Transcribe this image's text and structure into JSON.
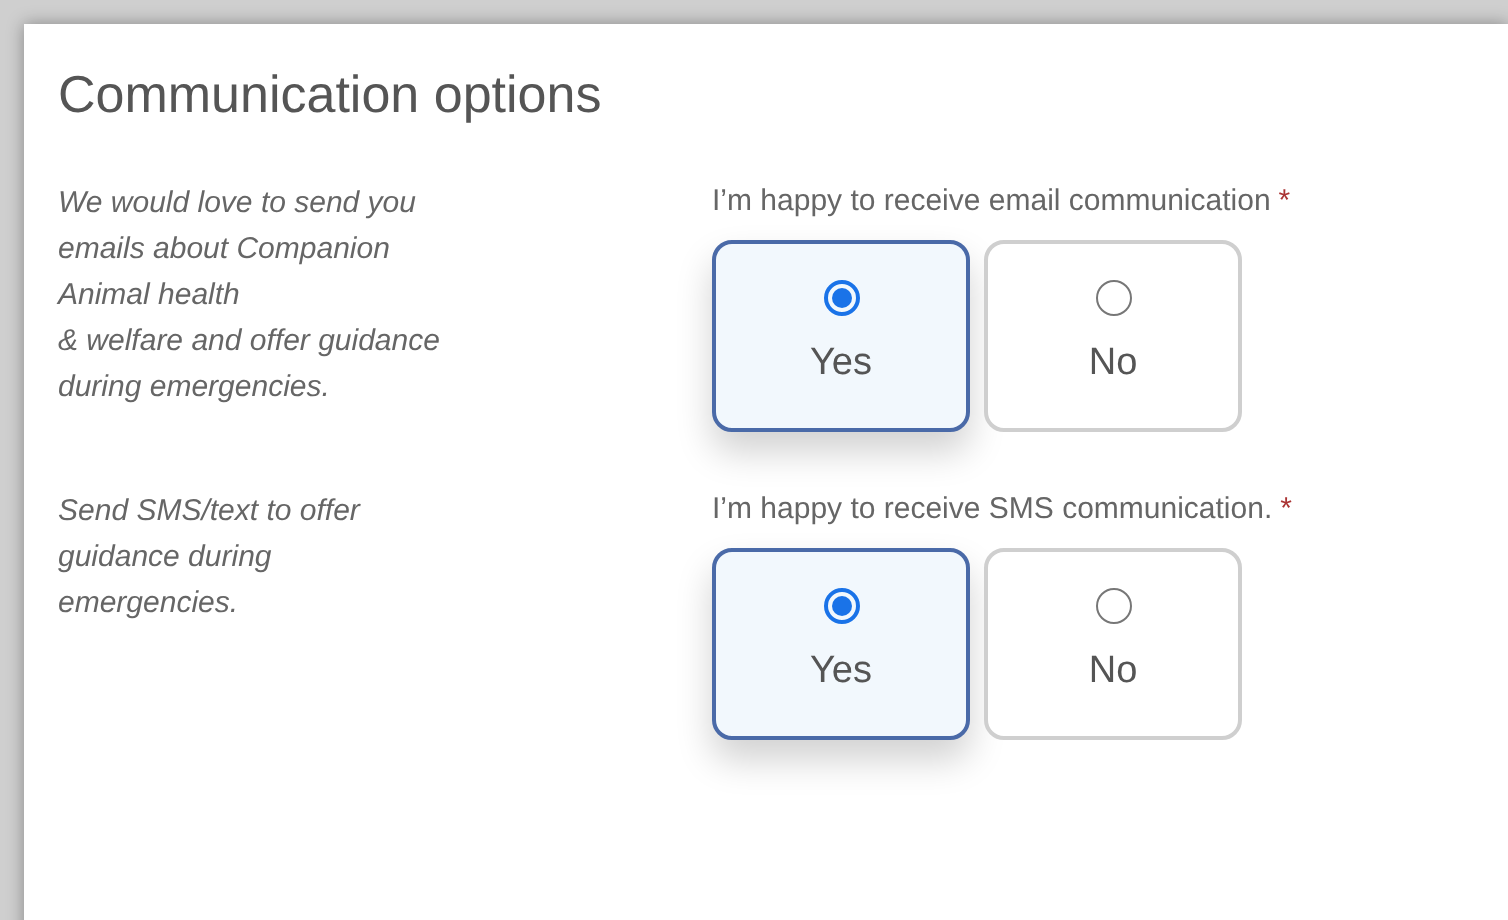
{
  "title": "Communication options",
  "questions": [
    {
      "description": "We would love to send you\nemails about Companion\nAnimal health\n& welfare and offer guidance\nduring emergencies.",
      "label": "I’m happy to receive email communication",
      "required_mark": "*",
      "options": [
        {
          "label": "Yes",
          "selected": true
        },
        {
          "label": "No",
          "selected": false
        }
      ]
    },
    {
      "description": "Send SMS/text to offer\nguidance during\nemergencies.",
      "label": "I’m happy to receive SMS communication.",
      "required_mark": "*",
      "options": [
        {
          "label": "Yes",
          "selected": true
        },
        {
          "label": "No",
          "selected": false
        }
      ]
    }
  ]
}
